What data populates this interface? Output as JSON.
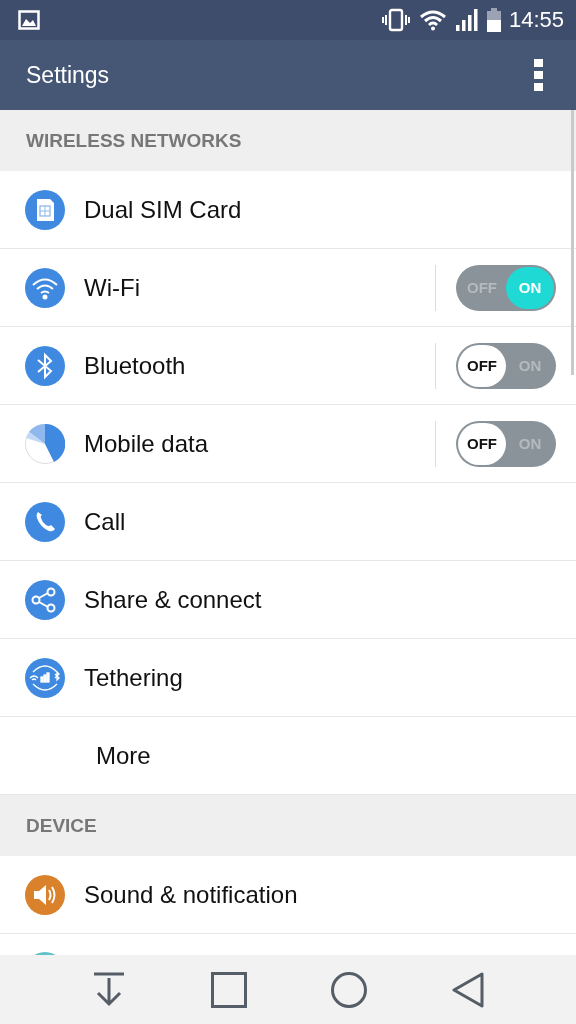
{
  "status_bar": {
    "time": "14:55"
  },
  "app_bar": {
    "title": "Settings"
  },
  "sections": [
    {
      "title": "WIRELESS NETWORKS",
      "items": [
        {
          "kind": "plain",
          "label": "Dual SIM Card",
          "color": "#3f8ae0"
        },
        {
          "kind": "toggle",
          "label": "Wi-Fi",
          "color": "#3f8ae0",
          "on": true,
          "off_label": "OFF",
          "on_label": "ON"
        },
        {
          "kind": "toggle",
          "label": "Bluetooth",
          "color": "#3f8ae0",
          "on": false,
          "off_label": "OFF",
          "on_label": "ON"
        },
        {
          "kind": "toggle",
          "label": "Mobile data",
          "color": "#3f8ae0",
          "on": false,
          "off_label": "OFF",
          "on_label": "ON"
        },
        {
          "kind": "plain",
          "label": "Call",
          "color": "#3f8ae0"
        },
        {
          "kind": "plain",
          "label": "Share & connect",
          "color": "#3f8ae0"
        },
        {
          "kind": "plain",
          "label": "Tethering",
          "color": "#3f8ae0"
        },
        {
          "kind": "text",
          "label": "More"
        }
      ]
    },
    {
      "title": "DEVICE",
      "items": [
        {
          "kind": "plain",
          "label": "Sound & notification",
          "color": "#d9822b"
        },
        {
          "kind": "partial",
          "color": "#5fc2c6"
        }
      ]
    }
  ]
}
